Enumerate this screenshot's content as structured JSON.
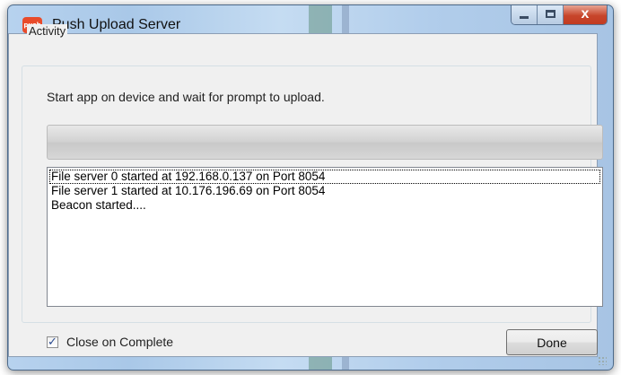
{
  "window": {
    "title": "Push Upload Server",
    "icon_text": "push",
    "close_glyph": "x"
  },
  "activity": {
    "legend": "Activity",
    "instruction": "Start app on device and wait for prompt to upload.",
    "progress_fraction": 0
  },
  "log": {
    "lines": [
      "File server 0 started at 192.168.0.137 on Port 8054",
      "File server 1 started at 10.176.196.69 on Port 8054",
      "Beacon started...."
    ]
  },
  "options": {
    "close_on_complete_label": "Close on Complete",
    "close_on_complete_checked": true,
    "check_glyph": "✓"
  },
  "buttons": {
    "done_label": "Done"
  },
  "colors": {
    "app_icon": "#e84b2a",
    "close_button": "#c7452b"
  },
  "icons": [
    "app-push-icon",
    "minimize-icon",
    "maximize-icon",
    "close-icon",
    "check-icon",
    "resize-grip-icon"
  ]
}
